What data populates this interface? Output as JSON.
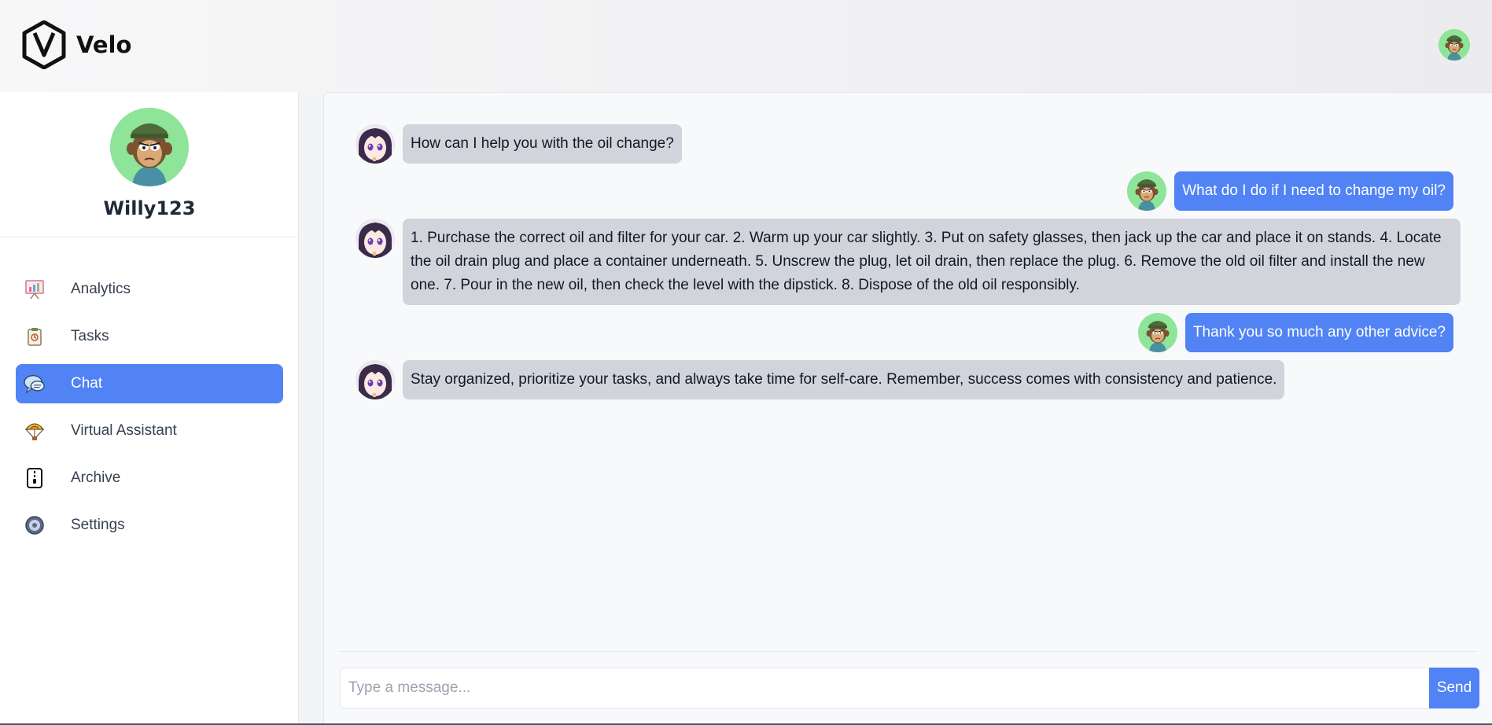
{
  "header": {
    "brand": "Velo",
    "logo_icon": "velo-shield-logo",
    "user_avatar_icon": "monkey-avatar"
  },
  "profile": {
    "username": "Willy123",
    "avatar_icon": "monkey-avatar"
  },
  "sidebar": {
    "items": [
      {
        "label": "Analytics",
        "icon": "analytics-board-icon",
        "active": false
      },
      {
        "label": "Tasks",
        "icon": "tasks-clipboard-icon",
        "active": false
      },
      {
        "label": "Chat",
        "icon": "chat-bubbles-icon",
        "active": true
      },
      {
        "label": "Virtual Assistant",
        "icon": "parachute-icon",
        "active": false
      },
      {
        "label": "Archive",
        "icon": "archive-zipper-icon",
        "active": false
      },
      {
        "label": "Settings",
        "icon": "gear-icon",
        "active": false
      }
    ]
  },
  "chat": {
    "messages": [
      {
        "sender": "bot",
        "text": "How can I help you with the oil change?"
      },
      {
        "sender": "user",
        "text": "What do I do if I need to change my oil?"
      },
      {
        "sender": "bot",
        "text": "1. Purchase the correct oil and filter for your car. 2. Warm up your car slightly. 3. Put on safety glasses, then jack up the car and place it on stands. 4. Locate the oil drain plug and place a container underneath. 5. Unscrew the plug, let oil drain, then replace the plug. 6. Remove the old oil filter and install the new one. 7. Pour in the new oil, then check the level with the dipstick. 8. Dispose of the old oil responsibly."
      },
      {
        "sender": "user",
        "text": "Thank you so much any other advice?"
      },
      {
        "sender": "bot",
        "text": "Stay organized, prioritize your tasks, and always take time for self-care. Remember, success comes with consistency and patience."
      }
    ],
    "composer": {
      "placeholder": "Type a message...",
      "value": "",
      "send_label": "Send"
    }
  },
  "colors": {
    "accent": "#5183f5",
    "bot_bubble": "#d1d5db",
    "avatar_bg": "#8ee59a"
  }
}
